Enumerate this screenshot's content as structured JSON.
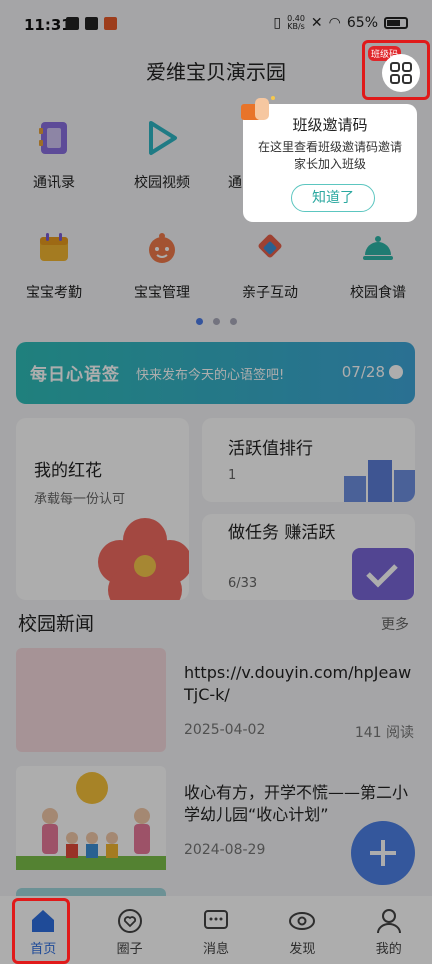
{
  "status_bar": {
    "time": "11:31",
    "net_speed_top": "0.40",
    "net_speed_bottom": "KB/s",
    "battery": "65%"
  },
  "header": {
    "title": "爱维宝贝演示园",
    "qr_badge": "班级码"
  },
  "grid": {
    "row1": [
      {
        "label": "通讯录",
        "icon": "contacts-icon",
        "color": "#7b5cd6"
      },
      {
        "label": "校园视频",
        "icon": "video-play-icon",
        "color": "#2fb6c4"
      },
      {
        "label": "通",
        "icon": "notice-icon",
        "color": "#e6a23c"
      },
      {
        "label": "",
        "icon": "",
        "color": "#999999"
      }
    ],
    "row2": [
      {
        "label": "宝宝考勤",
        "icon": "calendar-icon",
        "color": "#f2b632"
      },
      {
        "label": "宝宝管理",
        "icon": "baby-face-icon",
        "color": "#f07a4a"
      },
      {
        "label": "亲子互动",
        "icon": "interact-icon",
        "color": "#e8604a"
      },
      {
        "label": "校园食谱",
        "icon": "food-dome-icon",
        "color": "#2fb6a8"
      }
    ]
  },
  "banner": {
    "title": "每日心语签",
    "subtitle": "快来发布今天的心语签吧!",
    "date": "07/28"
  },
  "cards": {
    "red_flower": {
      "title": "我的红花",
      "subtitle": "承载每一份认可"
    },
    "activity": {
      "title": "活跃值排行",
      "value": "1"
    },
    "tasks": {
      "title": "做任务 赚活跃",
      "value": "6/33"
    }
  },
  "news": {
    "section_title": "校园新闻",
    "more": "更多",
    "items": [
      {
        "title": "https://v.douyin.com/hpJeawTjC-k/",
        "date": "2025-04-02",
        "reads": "141 阅读"
      },
      {
        "title": "收心有方，开学不慌——第二小学幼儿园“收心计划”",
        "date": "2024-08-29",
        "reads": ""
      }
    ]
  },
  "popup": {
    "title": "班级邀请码",
    "body": "在这里查看班级邀请码邀请家长加入班级",
    "button": "知道了"
  },
  "tabbar": {
    "items": [
      {
        "label": "首页",
        "icon": "home-icon"
      },
      {
        "label": "圈子",
        "icon": "heart-circle-icon"
      },
      {
        "label": "消息",
        "icon": "message-icon"
      },
      {
        "label": "发现",
        "icon": "eye-icon"
      },
      {
        "label": "我的",
        "icon": "person-icon"
      }
    ]
  },
  "colors": {
    "accent": "#2e6fe0",
    "highlight": "#e01a1a",
    "banner": "#2fbdb8"
  }
}
